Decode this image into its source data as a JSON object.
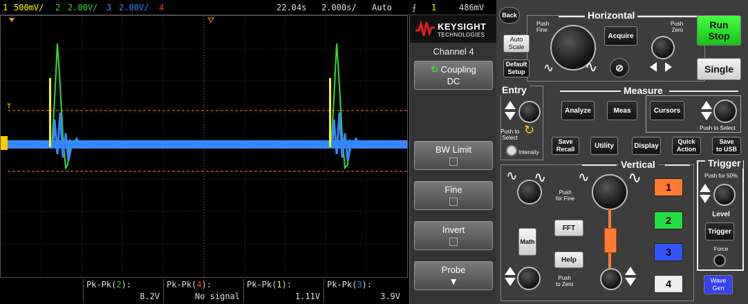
{
  "topbar": {
    "ch1_num": "1",
    "ch1_scale": "500mV/",
    "ch2_num": "2",
    "ch2_scale": "2.00V/",
    "ch3_num": "3",
    "ch3_scale": "2.00V/",
    "ch4_num": "4",
    "delay": "22.04s",
    "timebase": "2.000s/",
    "trigger_mode": "Auto",
    "trigger_symbol": "⨍",
    "trigger_source": "1",
    "trigger_level": "486mV"
  },
  "measurements": [
    {
      "label_pre": "Pk-Pk(",
      "ch": "2",
      "label_post": "):",
      "value": "8.2V"
    },
    {
      "label_pre": "Pk-Pk(",
      "ch": "4",
      "label_post": "):",
      "value": "No signal"
    },
    {
      "label_pre": "Pk-Pk(",
      "ch": "1",
      "label_post": "):",
      "value": "1.11V"
    },
    {
      "label_pre": "Pk-Pk(",
      "ch": "3",
      "label_post": "):",
      "value": "3.9V"
    }
  ],
  "softmenu": {
    "brand": "KEYSIGHT",
    "brand_sub": "TECHNOLOGIES",
    "title": "Channel 4",
    "coupling_label": "Coupling",
    "coupling_value": "DC",
    "bw_limit": "BW Limit",
    "fine": "Fine",
    "invert": "Invert",
    "probe": "Probe"
  },
  "panel": {
    "back": "Back",
    "horizontal": "Horizontal",
    "push_fine": "Push\nFine",
    "push_zero": "Push\nZero",
    "auto_scale": "Auto\nScale",
    "acquire": "Acquire",
    "default_setup": "Default\nSetup",
    "run_stop": "Run\nStop",
    "single": "Single",
    "entry": "Entry",
    "push_to_select": "Push to\nSelect",
    "intensity": "Intensity",
    "measure": "Measure",
    "analyze": "Analyze",
    "meas": "Meas",
    "cursors": "Cursors",
    "push_to_select_2": "Push to Select",
    "save_recall": "Save\nRecall",
    "utility": "Utility",
    "display": "Display",
    "quick_action": "Quick\nAction",
    "save_to_usb": "Save\nto USB",
    "vertical": "Vertical",
    "push_for_fine": "Push\nfor Fine",
    "fft": "FFT",
    "math": "Math",
    "help": "Help",
    "push_to_zero": "Push\nto Zero",
    "trigger": "Trigger",
    "push_for_50": "Push for 50%",
    "level": "Level",
    "trigger_btn": "Trigger",
    "force": "Force",
    "ch1": "1",
    "ch2": "2",
    "ch3": "3",
    "ch4": "4",
    "wave_gen": "Wave\nGen"
  },
  "colors": {
    "ch1": "#ffff00",
    "ch2": "#33dd33",
    "ch3": "#3388ff",
    "ch4": "#ff3333",
    "run_stop": "#22dd22",
    "ch1_btn": "#ff7a30",
    "ch2_btn": "#22dd44",
    "ch3_btn": "#3355ff",
    "ch4_btn": "#eeeeee",
    "wavegen": "#3344ee"
  }
}
